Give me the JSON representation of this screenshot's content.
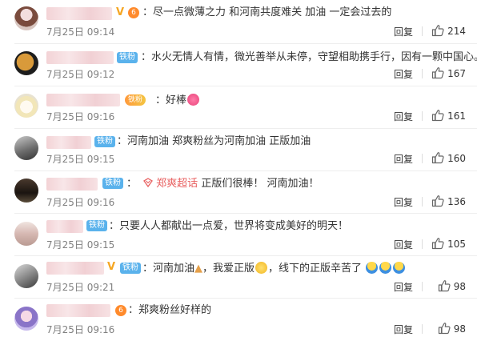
{
  "comments": [
    {
      "text": "尽一点微薄之力 和河南共度难关  加油 一定会过去的",
      "date": "7月25日 09:14",
      "reply": "回复",
      "likes": "214",
      "badge": "",
      "vip": "V"
    },
    {
      "text": "水火无情人有情，微光善举从未停，守望相助携手行，因有一颗中国心。",
      "date": "7月25日 09:12",
      "reply": "回复",
      "likes": "167",
      "badge": "铁粉"
    },
    {
      "text": "好棒",
      "date": "7月25日 09:16",
      "reply": "回复",
      "likes": "161",
      "badge": "铁粉"
    },
    {
      "text": "河南加油 郑爽粉丝为河南加油 正版加油",
      "date": "7月25日 09:15",
      "reply": "回复",
      "likes": "160",
      "badge": "铁粉"
    },
    {
      "topic": "郑爽超话",
      "text": "正版们很棒！ 河南加油！",
      "date": "7月25日 09:16",
      "reply": "回复",
      "likes": "136",
      "badge": "铁粉"
    },
    {
      "text": "只要人人都献出一点爱，世界将变成美好的明天！",
      "date": "7月25日 09:15",
      "reply": "回复",
      "likes": "105",
      "badge": "铁粉"
    },
    {
      "text_a": "河南加油",
      "text_b": "，我爱正版",
      "text_c": "，线下的正版辛苦了",
      "date": "7月25日 09:21",
      "reply": "回复",
      "likes": "98",
      "badge": "铁粉",
      "vip": "V"
    },
    {
      "text": "郑爽粉丝好样的",
      "date": "7月25日 09:16",
      "reply": "回复",
      "likes": "98"
    }
  ],
  "colon": "：",
  "icons": {
    "like": "thumbs-up-icon",
    "topic": "super-topic-icon",
    "heart": "heart-emoji",
    "pray": "pray-emoji"
  }
}
